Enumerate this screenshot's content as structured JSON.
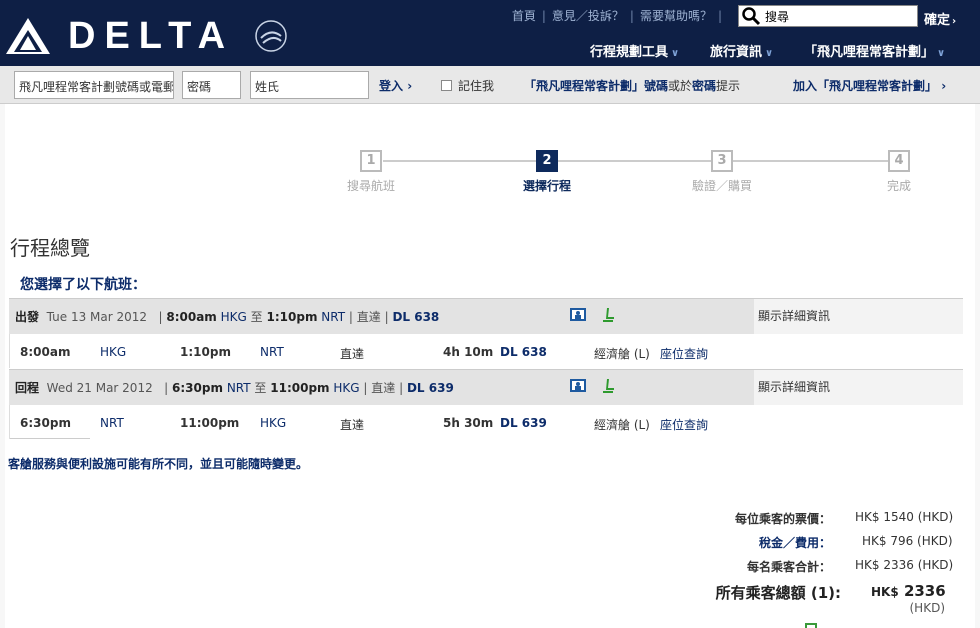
{
  "header": {
    "brand": "DELTA",
    "seal_text": "SKYTEAM",
    "top_links": [
      "首頁",
      "意見／投訴？",
      "需要幫助嗎？"
    ],
    "search_value": "搜尋",
    "search_button": "確定",
    "nav": [
      "行程規劃工具",
      "旅行資訊",
      "「飛凡哩程常客計劃」"
    ],
    "colors": {
      "header_bg": "#0e1f45",
      "link": "#0d2c6a"
    }
  },
  "login": {
    "account_placeholder": "飛凡哩程常客計劃號碼或電郵",
    "password_placeholder": "密碼",
    "lastname_placeholder": "姓氏",
    "login_button": "登入",
    "remember_me": "記住我",
    "hint_part1": "「飛凡哩程常客計劃」號碼",
    "hint_or": "或於",
    "hint_part2": "密碼",
    "hint_suffix": "提示",
    "join": "加入「飛凡哩程常客計劃」"
  },
  "steps": [
    {
      "num": "1",
      "label": "搜尋航班",
      "active": false
    },
    {
      "num": "2",
      "label": "選擇行程",
      "active": true
    },
    {
      "num": "3",
      "label": "驗證／購買",
      "active": false
    },
    {
      "num": "4",
      "label": "完成",
      "active": false
    }
  ],
  "page_title": "行程總覽",
  "selected_heading": "您選擇了以下航班：",
  "flights": [
    {
      "direction": "出發",
      "date": "Tue 13 Mar 2012",
      "dep_time": "8:00am",
      "dep_airport": "HKG",
      "to": "至",
      "arr_time": "1:10pm",
      "arr_airport": "NRT",
      "stops": "直達",
      "flight_no": "DL 638",
      "details_link": "顯示詳細資訊",
      "duration": "4h 10m",
      "cabin": "經濟艙 (L)",
      "seat_link": "座位查詢"
    },
    {
      "direction": "回程",
      "date": "Wed 21 Mar 2012",
      "dep_time": "6:30pm",
      "dep_airport": "NRT",
      "to": "至",
      "arr_time": "11:00pm",
      "arr_airport": "HKG",
      "stops": "直達",
      "flight_no": "DL 639",
      "details_link": "顯示詳細資訊",
      "duration": "5h 30m",
      "cabin": "經濟艙 (L)",
      "seat_link": "座位查詢"
    }
  ],
  "disclaimer": "客艙服務與便利設施可能有所不同，並且可能隨時變更。",
  "pricing": {
    "fare_label": "每位乘客的票價：",
    "fare_value": "HK$ 1540 (HKD)",
    "tax_label": "稅金／費用：",
    "tax_value": "HK$ 796 (HKD)",
    "per_total_label": "每名乘客合計：",
    "per_total_value": "HK$ 2336 (HKD)",
    "grand_label": "所有乘客總額 (1):",
    "grand_currency": "HK$",
    "grand_value": "2336",
    "grand_unit": "(HKD)"
  }
}
